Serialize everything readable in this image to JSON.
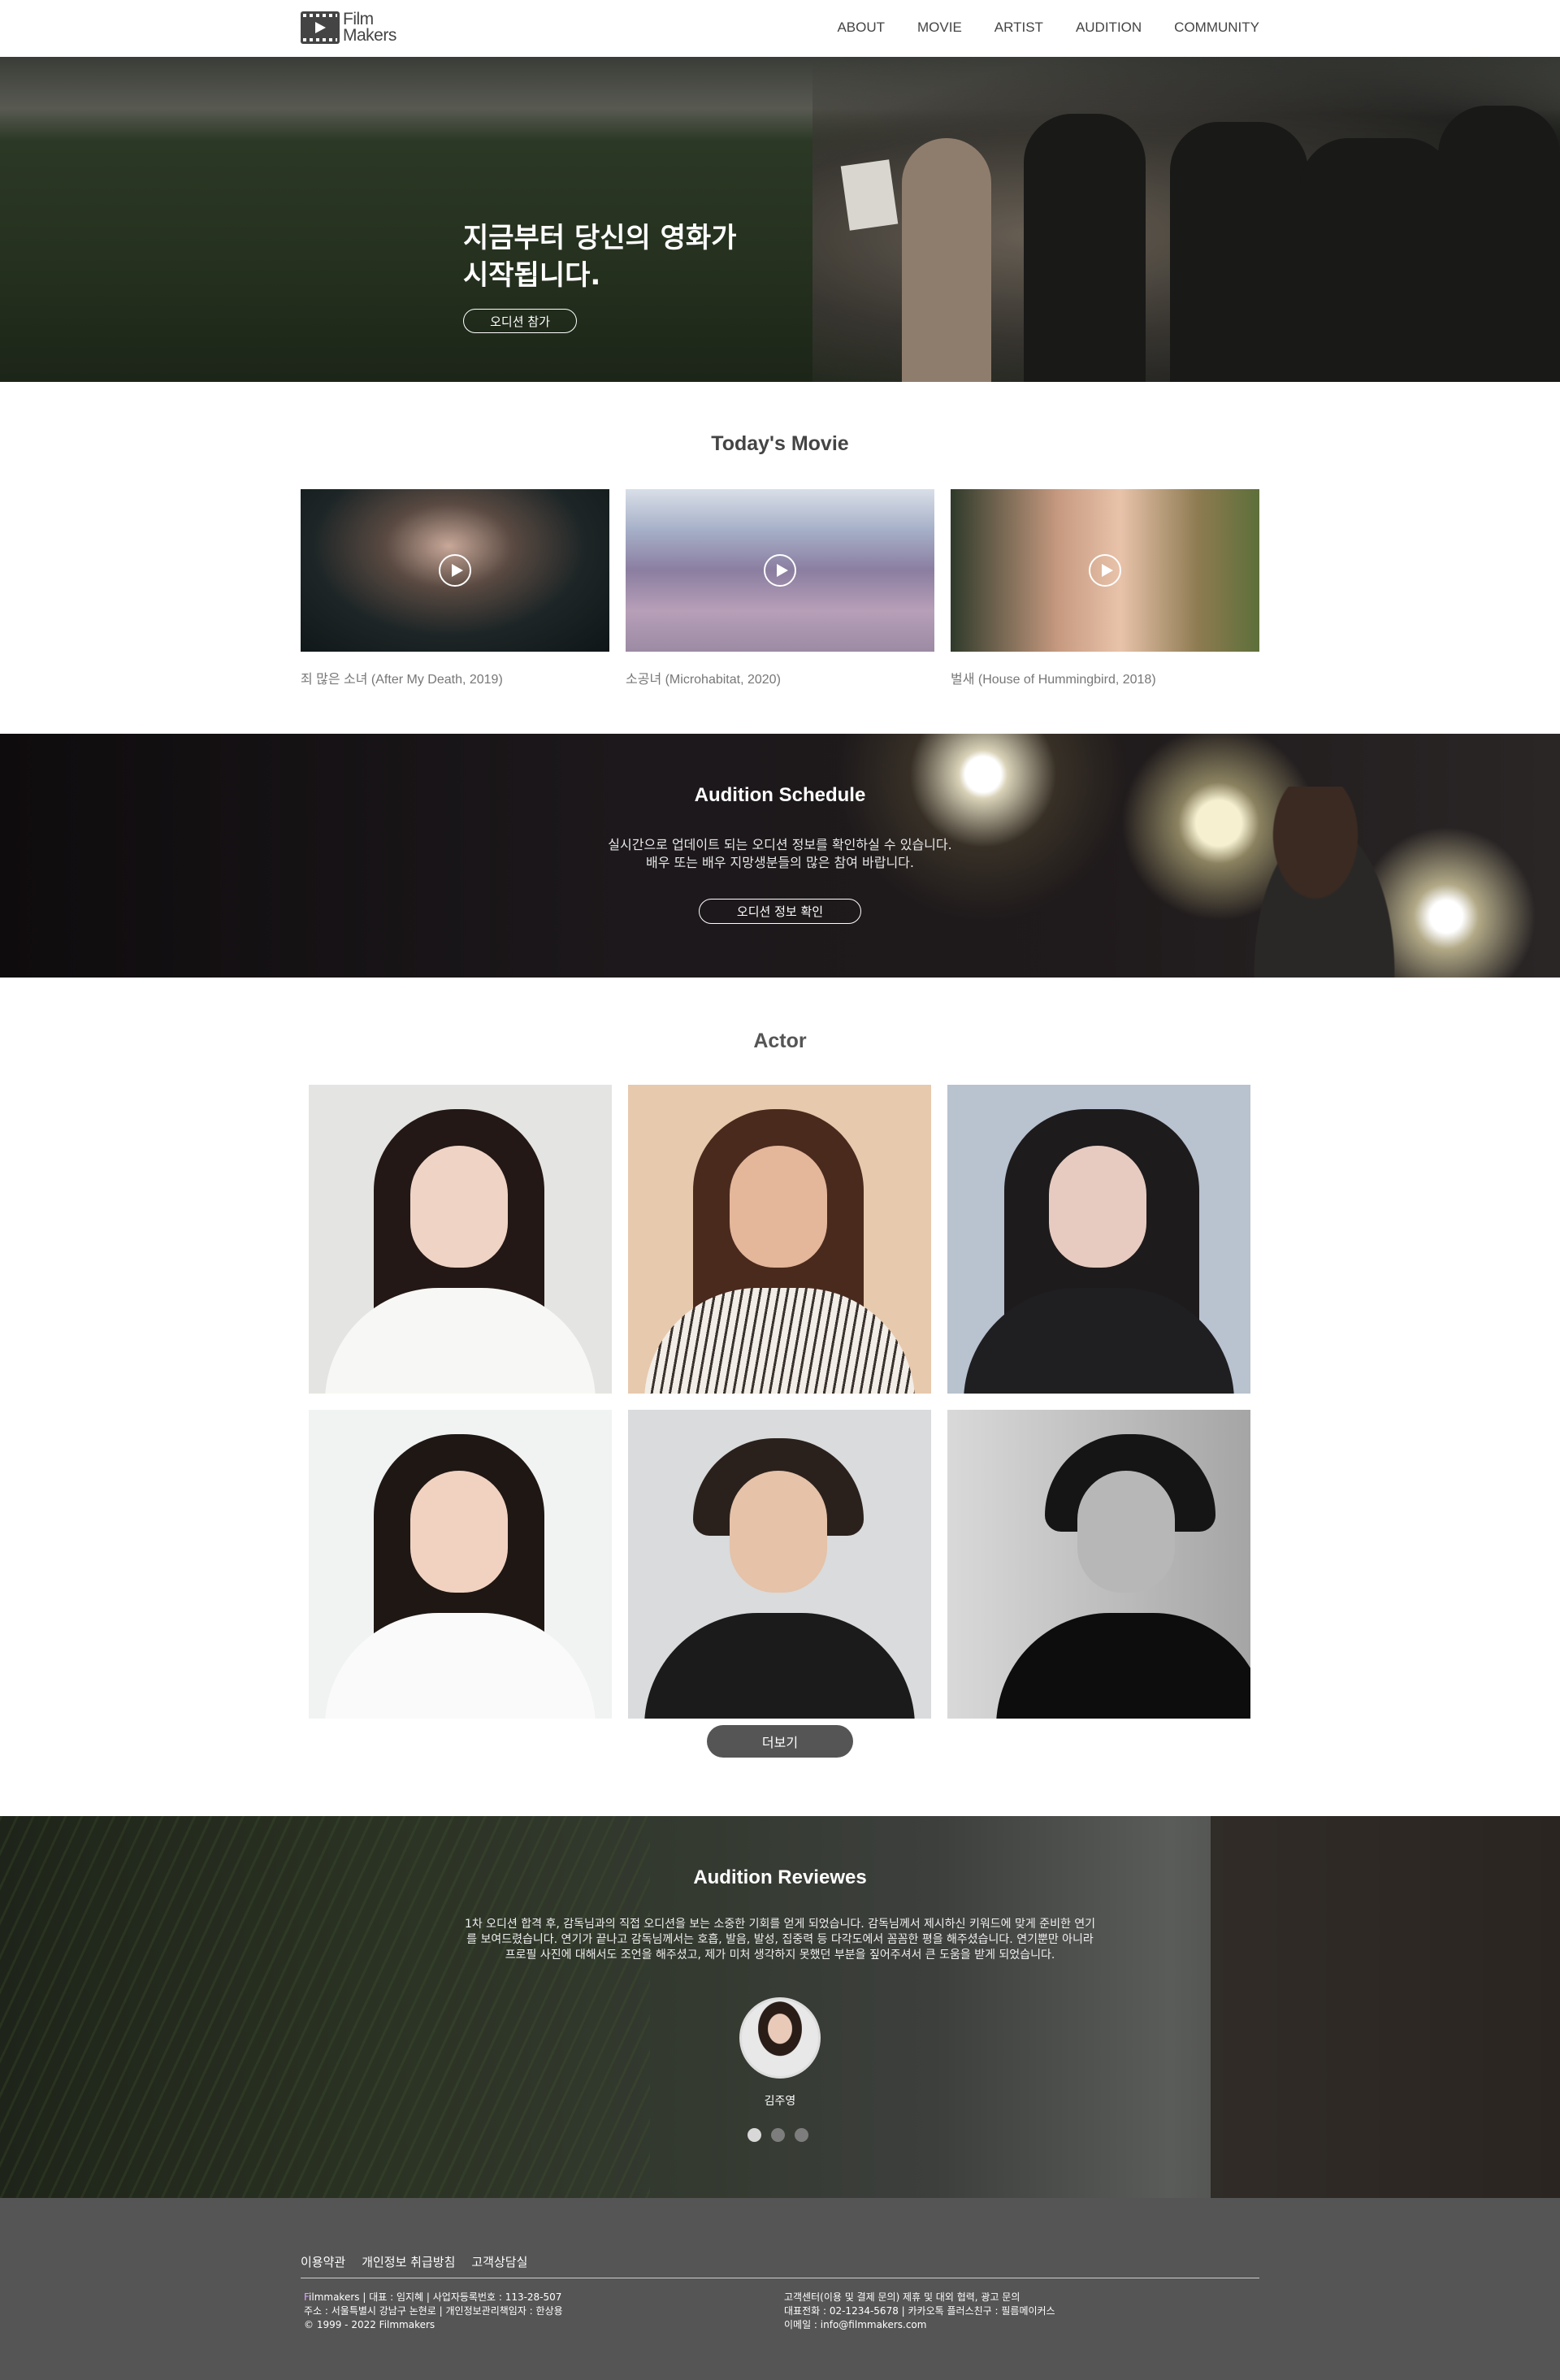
{
  "header": {
    "logo_line1": "Film",
    "logo_line2": "Makers",
    "nav": [
      "ABOUT",
      "MOVIE",
      "ARTIST",
      "AUDITION",
      "COMMUNITY"
    ]
  },
  "hero": {
    "title_line1": "지금부터 당신의 영화가",
    "title_line2": "시작됩니다.",
    "cta": "오디션 참가"
  },
  "today": {
    "title": "Today's Movie",
    "movies": [
      {
        "caption": "죄 많은 소녀 (After My Death, 2019)"
      },
      {
        "caption": "소공녀 (Microhabitat, 2020)"
      },
      {
        "caption": "벌새 (House of Hummingbird, 2018)"
      }
    ]
  },
  "schedule": {
    "title": "Audition Schedule",
    "line1": "실시간으로 업데이트 되는 오디션 정보를 확인하실 수 있습니다.",
    "line2": "배우 또는 배우 지망생분들의 많은 참여 바랍니다.",
    "cta": "오디션 정보 확인"
  },
  "actor": {
    "title": "Actor",
    "more": "더보기"
  },
  "reviews": {
    "title": "Audition Reviewes",
    "text": "1차 오디션 합격 후, 감독님과의 직접 오디션을 보는 소중한 기회를 얻게 되었습니다. 감독님께서 제시하신 키워드에 맞게 준비한 연기를 보여드렸습니다. 연기가 끝나고 감독님께서는 호흡, 발음, 발성, 집중력 등 다각도에서 꼼꼼한 평을 해주셨습니다. 연기뿐만 아니라 프로필 사진에 대해서도 조언을 해주셨고, 제가 미처 생각하지 못했던 부분을 짚어주셔서 큰 도움을 받게 되었습니다.",
    "reviewer": "김주영",
    "active_slide": 1,
    "slide_count": 3
  },
  "footer": {
    "links": [
      "이용약관",
      "개인정보 취급방침",
      "고객상담실"
    ],
    "brand_f": "F",
    "left_line1_rest": "ilmmakers | 대표 : 임지혜 | 사업자등록번호 : 113-28-507",
    "left_line2": "주소 : 서울특별시 강남구 논현로 | 개인정보관리책임자 : 한상용",
    "left_line3": "© 1999 - 2022 Filmmakers",
    "right_line1": "고객센터(이용 및 결제 문의) 제휴 및 대외 협력, 광고 문의",
    "right_line2": "대표전화 : 02-1234-5678 | 카카오톡 플러스친구 : 필름메이커스",
    "right_line3": "이메일 : info@filmmakers.com"
  }
}
